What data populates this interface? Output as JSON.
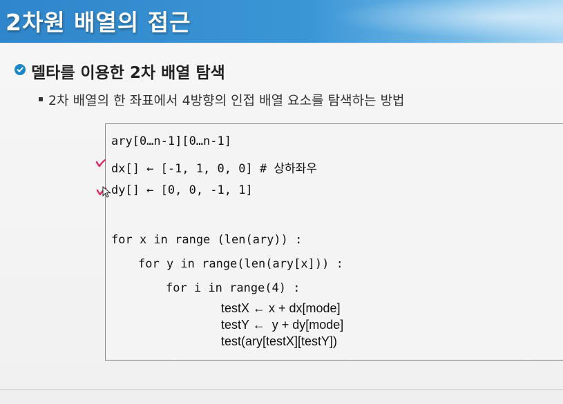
{
  "slide": {
    "title": "2차원 배열의 접근",
    "heading": "델타를 이용한 2차 배열 탐색",
    "bullet": "2차 배열의 한 좌표에서 4방향의 인접 배열 요소를 탐색하는 방법"
  },
  "code": {
    "line1": "ary[0…n-1][0…n-1]",
    "line2": "dx[] ← [-1, 1, 0, 0] # 상하좌우",
    "line3": "dy[] ← [0, 0, -1, 1]",
    "line4": "for x in range (len(ary)) :",
    "line5": "for y in range(len(ary[x])) :",
    "line6": "for i in range(4) :",
    "line7": "testX ← x + dx[mode]",
    "line8": "testY ←  y + dy[mode]",
    "line9": "test(ary[testX][testY])"
  },
  "colors": {
    "title_bar": "#3b96d6",
    "check_icon": "#1a87c9",
    "annotation": "#e0245e"
  },
  "icons": {
    "heading_bullet": "check-circle-icon",
    "sub_bullet": "square-bullet-icon",
    "pen_marks": "pen-checkmark-icon",
    "cursor": "mouse-pointer-icon"
  }
}
